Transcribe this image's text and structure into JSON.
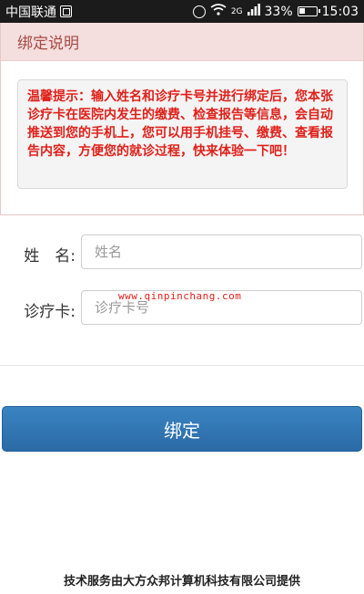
{
  "status_bar": {
    "carrier": "中国联通",
    "network": "2G",
    "battery": "33%",
    "time": "15:03"
  },
  "panel": {
    "title": "绑定说明",
    "notice": "温馨提示：输入姓名和诊疗卡号并进行绑定后，您本张诊疗卡在医院内发生的缴费、检查报告等信息，会自动推送到您的手机上，您可以用手机挂号、缴费、查看报告内容，方便您的就诊过程，快来体验一下吧！"
  },
  "form": {
    "name_label": "姓　名:",
    "name_placeholder": "姓名",
    "card_label": "诊疗卡:",
    "card_placeholder": "诊疗卡号"
  },
  "watermark": "www.qinpinchang.com",
  "bind_button": "绑定",
  "footer": "技术服务由大方众邦计算机科技有限公司提供"
}
